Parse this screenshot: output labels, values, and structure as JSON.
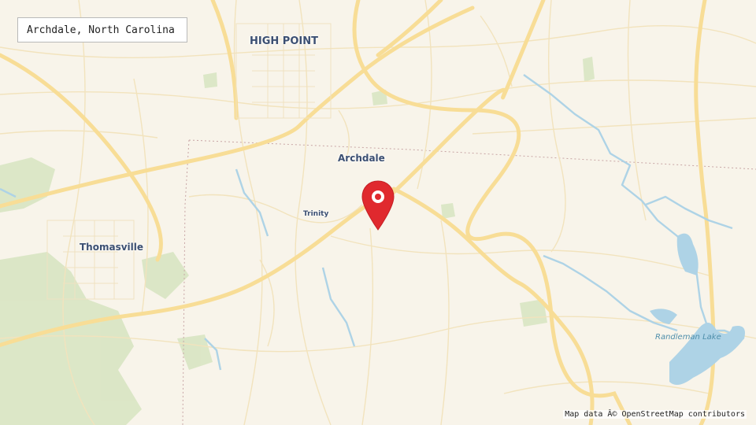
{
  "search": {
    "value": "Archdale, North Carolina"
  },
  "places": {
    "high_point": "HIGH POINT",
    "archdale": "Archdale",
    "trinity": "Trinity",
    "thomasville": "Thomasville"
  },
  "water": {
    "randleman_lake": "Randleman Lake"
  },
  "attribution": "Map data Â© OpenStreetMap contributors",
  "marker": {
    "icon": "map-pin-icon",
    "color": "#e0292e"
  },
  "colors": {
    "land": "#f8f4ea",
    "major_road": "#fbe3a3",
    "minor_road": "#f3e6c4",
    "water": "#aed3e6",
    "park": "#d8e5c3"
  }
}
